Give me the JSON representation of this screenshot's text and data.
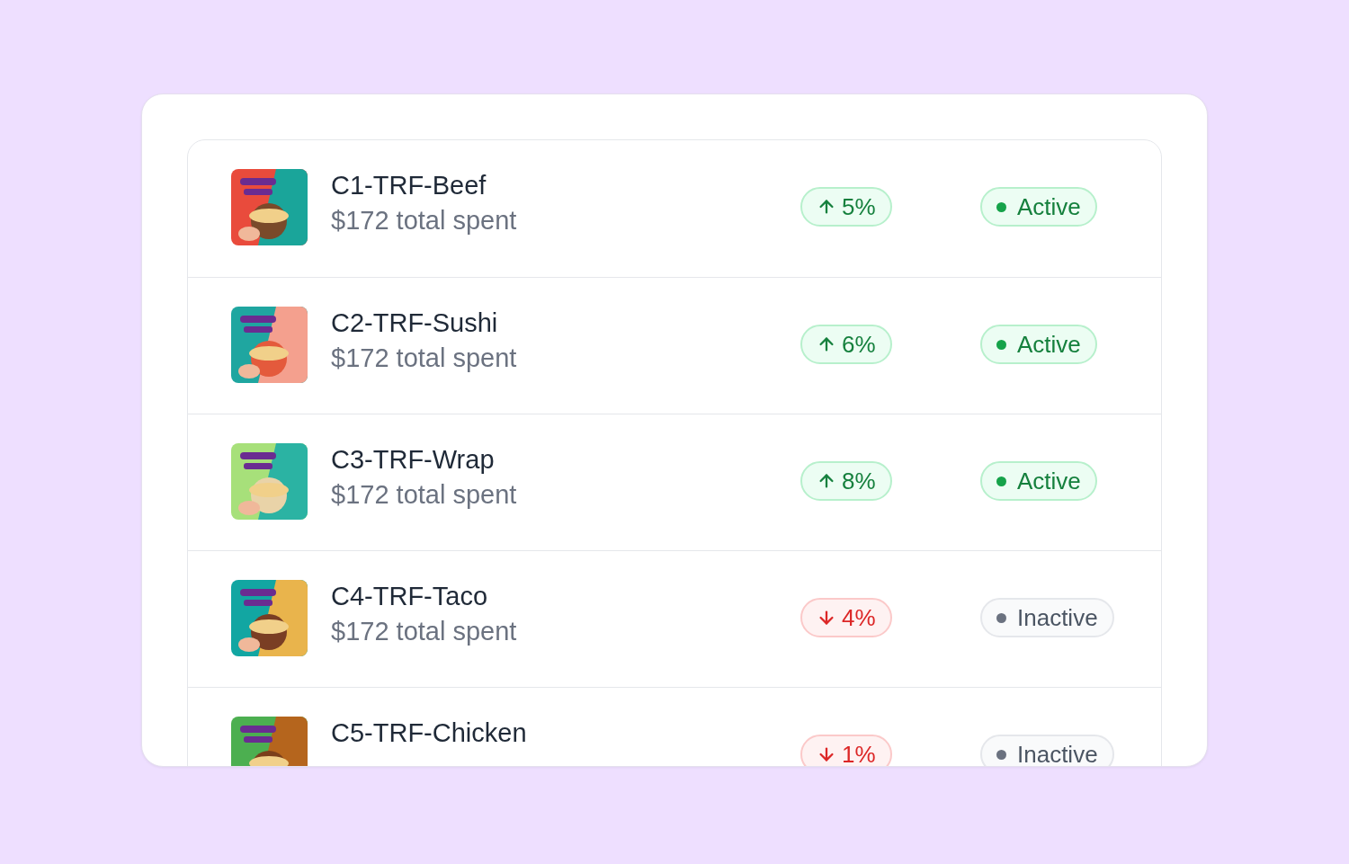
{
  "campaigns": [
    {
      "name": "C1-TRF-Beef",
      "subtitle": "$172 total spent",
      "trend": {
        "rising": true,
        "value": "5%"
      },
      "status": {
        "label": "Active",
        "active": true
      }
    },
    {
      "name": "C2-TRF-Sushi",
      "subtitle": "$172 total spent",
      "trend": {
        "rising": true,
        "value": "6%"
      },
      "status": {
        "label": "Active",
        "active": true
      }
    },
    {
      "name": "C3-TRF-Wrap",
      "subtitle": "$172 total spent",
      "trend": {
        "rising": true,
        "value": "8%"
      },
      "status": {
        "label": "Active",
        "active": true
      }
    },
    {
      "name": "C4-TRF-Taco",
      "subtitle": "$172 total spent",
      "trend": {
        "rising": false,
        "value": "4%"
      },
      "status": {
        "label": "Inactive",
        "active": false
      }
    },
    {
      "name": "C5-TRF-Chicken",
      "trend": {
        "rising": false,
        "value": "1%"
      },
      "status": {
        "label": "Inactive",
        "active": false
      }
    }
  ]
}
